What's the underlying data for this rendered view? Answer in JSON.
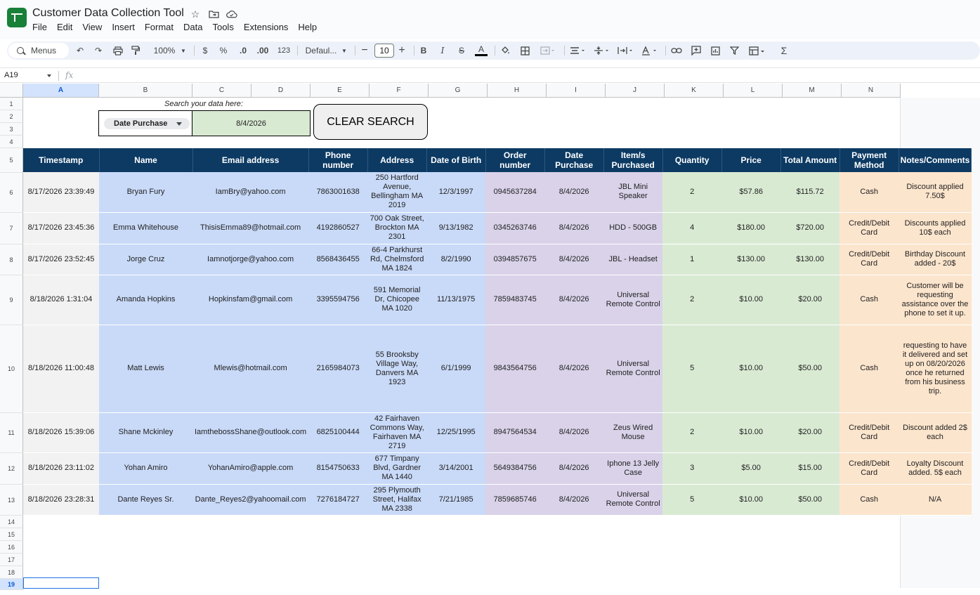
{
  "app": {
    "title": "Customer Data Collection Tool",
    "menu": [
      "File",
      "Edit",
      "View",
      "Insert",
      "Format",
      "Data",
      "Tools",
      "Extensions",
      "Help"
    ]
  },
  "toolbar": {
    "search_label": "Menus",
    "zoom": "100%",
    "currency": "$",
    "percent": "%",
    "decrease_decimal": ".0",
    "increase_decimal": ".00",
    "number_format": "123",
    "font": "Defaul...",
    "font_size": "10",
    "bold": "B",
    "italic": "I",
    "strike": "S",
    "text_color": "A",
    "sum": "Σ"
  },
  "formula_bar": {
    "cell_ref": "A19",
    "fx": "fx"
  },
  "columns": [
    "A",
    "B",
    "C",
    "D",
    "E",
    "F",
    "G",
    "H",
    "I",
    "J",
    "K",
    "L",
    "M",
    "N"
  ],
  "selected_column": "A",
  "row_numbers": [
    "1",
    "2",
    "3",
    "4",
    "5",
    "6",
    "7",
    "8",
    "9",
    "10",
    "11",
    "12",
    "13",
    "14",
    "15",
    "16",
    "17",
    "18",
    "19"
  ],
  "selected_row": "19",
  "search": {
    "label": "Search your data here:",
    "filter_field": "Date Purchase",
    "value": "8/4/2026",
    "clear_button": "CLEAR SEARCH"
  },
  "table": {
    "headers": [
      "Timestamp",
      "Name",
      "Email address",
      "Phone number",
      "Address",
      "Date of Birth",
      "Order number",
      "Date Purchase",
      "Item/s Purchased",
      "Quantity",
      "Price",
      "Total Amount",
      "Payment Method",
      "Notes/Comments"
    ],
    "rows": [
      [
        "8/17/2026 23:39:49",
        "Bryan Fury",
        "IamBry@yahoo.com",
        "7863001638",
        "250 Hartford Avenue, Bellingham MA 2019",
        "12/3/1997",
        "0945637284",
        "8/4/2026",
        "JBL Mini Speaker",
        "2",
        "$57.86",
        "$115.72",
        "Cash",
        "Discount applied 7.50$"
      ],
      [
        "8/17/2026 23:45:36",
        "Emma Whitehouse",
        "ThisisEmma89@hotmail.com",
        "4192860527",
        "700 Oak Street, Brockton MA 2301",
        "9/13/1982",
        "0345263746",
        "8/4/2026",
        "HDD - 500GB",
        "4",
        "$180.00",
        "$720.00",
        "Credit/Debit Card",
        "Discounts applied 10$ each"
      ],
      [
        "8/17/2026 23:52:45",
        "Jorge Cruz",
        "Iamnotjorge@yahoo.com",
        "8568436455",
        "66-4 Parkhurst Rd, Chelmsford MA 1824",
        "8/2/1990",
        "0394857675",
        "8/4/2026",
        "JBL - Headset",
        "1",
        "$130.00",
        "$130.00",
        "Credit/Debit Card",
        "Birthday Discount added - 20$"
      ],
      [
        "8/18/2026 1:31:04",
        "Amanda Hopkins",
        "Hopkinsfam@gmail.com",
        "3395594756",
        "591 Memorial Dr, Chicopee MA 1020",
        "11/13/1975",
        "7859483745",
        "8/4/2026",
        "Universal Remote Control",
        "2",
        "$10.00",
        "$20.00",
        "Cash",
        "Customer will be requesting assistance over the phone to set it up."
      ],
      [
        "8/18/2026 11:00:48",
        "Matt Lewis",
        "Mlewis@hotmail.com",
        "2165984073",
        "55 Brooksby Village Way, Danvers MA 1923",
        "6/1/1999",
        "9843564756",
        "8/4/2026",
        "Universal Remote Control",
        "5",
        "$10.00",
        "$50.00",
        "Cash",
        "requesting to have it delivered and set up on 08/20/2026 once he returned from his business trip."
      ],
      [
        "8/18/2026 15:39:06",
        "Shane Mckinley",
        "IamthebossShane@outlook.com",
        "6825100444",
        "42 Fairhaven Commons Way, Fairhaven MA 2719",
        "12/25/1995",
        "8947564534",
        "8/4/2026",
        "Zeus Wired Mouse",
        "2",
        "$10.00",
        "$20.00",
        "Credit/Debit Card",
        "Discount added 2$ each"
      ],
      [
        "8/18/2026 23:11:02",
        "Yohan Amiro",
        "YohanAmiro@apple.com",
        "8154750633",
        "677 Timpany Blvd, Gardner MA 1440",
        "3/14/2001",
        "5649384756",
        "8/4/2026",
        "Iphone 13 Jelly Case",
        "3",
        "$5.00",
        "$15.00",
        "Credit/Debit Card",
        "Loyalty Discount added. 5$ each"
      ],
      [
        "8/18/2026 23:28:31",
        "Dante Reyes Sr.",
        "Dante_Reyes2@yahoomail.com",
        "7276184727",
        "295 Plymouth Street, Halifax MA 2338",
        "7/21/1985",
        "7859685746",
        "8/4/2026",
        "Universal Remote Control",
        "5",
        "$10.00",
        "$50.00",
        "Cash",
        "N/A"
      ]
    ]
  },
  "colors": {
    "header_bg": "#0c3a63",
    "timestamp_col": "#f2f2f2",
    "customer_cols": "#c9daf8",
    "order_cols": "#d9d2e9",
    "amount_cols": "#d9ead3",
    "payment_cols": "#fce5cd",
    "sheets_green": "#188038"
  }
}
